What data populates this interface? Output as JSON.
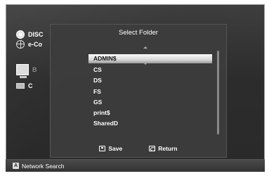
{
  "background_devices": [
    {
      "label": "DISC",
      "icon": "disc-icon"
    },
    {
      "label": "e-Co",
      "icon": "globe-icon"
    },
    {
      "label": "B",
      "icon": "pc-icon"
    },
    {
      "label": "C",
      "icon": "pc-small-icon"
    }
  ],
  "dialog": {
    "title": "Select Folder",
    "folders": [
      "ADMIN$",
      "CS",
      "DS",
      "FS",
      "GS",
      "print$",
      "SharedD"
    ],
    "selected_index": 0,
    "save_label": "Save",
    "return_label": "Return"
  },
  "bottom_bar": {
    "button_letter": "A",
    "label": "Network Search"
  },
  "colors": {
    "selected_highlight": "#e0e0e0",
    "dialog_bg": "#3c3c3c",
    "text": "#ffffff"
  }
}
